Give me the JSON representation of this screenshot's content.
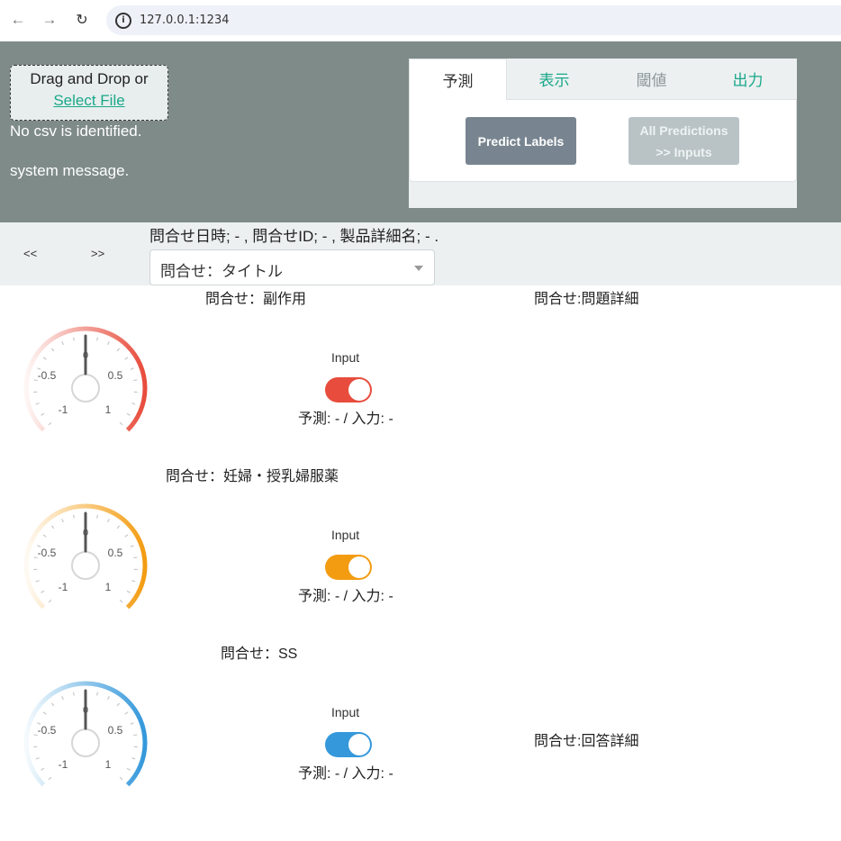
{
  "browser": {
    "url": "127.0.0.1:1234",
    "info_glyph": "i"
  },
  "upload": {
    "prompt": "Drag and Drop or",
    "link": "Select File",
    "status": "No csv is identified.",
    "system_message": "system message."
  },
  "tabs": [
    {
      "label": "予測",
      "active": true
    },
    {
      "label": "表示"
    },
    {
      "label": "閾値"
    },
    {
      "label": "出力"
    }
  ],
  "actions": {
    "predict": "Predict Labels",
    "all_predictions_line1": "All Predictions",
    "all_predictions_line2": ">> Inputs"
  },
  "nav": {
    "prev": "<<",
    "next": ">>",
    "meta": "問合せ日時; - , 問合せID; - , 製品詳細名; - .",
    "title_select": "問合せ：タイトル"
  },
  "details": {
    "problem": "問合せ:問題詳細",
    "answer": "問合せ:回答詳細"
  },
  "labels": [
    {
      "title": "問合せ：副作用",
      "color": "#e74c3c",
      "gauge_value": 0,
      "input_label": "Input",
      "status": "予測: - / 入力: -"
    },
    {
      "title": "問合せ：妊婦・授乳婦服薬",
      "color": "#f39c12",
      "gauge_value": 0,
      "input_label": "Input",
      "status": "予測: - / 入力: -"
    },
    {
      "title": "問合せ：SS",
      "color": "#3498db",
      "gauge_value": 0,
      "input_label": "Input",
      "status": "予測: - / 入力: -"
    }
  ],
  "gauge_ticks": {
    "center": "0",
    "neg_half": "-0.5",
    "pos_half": "0.5",
    "neg_one": "-1",
    "pos_one": "1"
  }
}
